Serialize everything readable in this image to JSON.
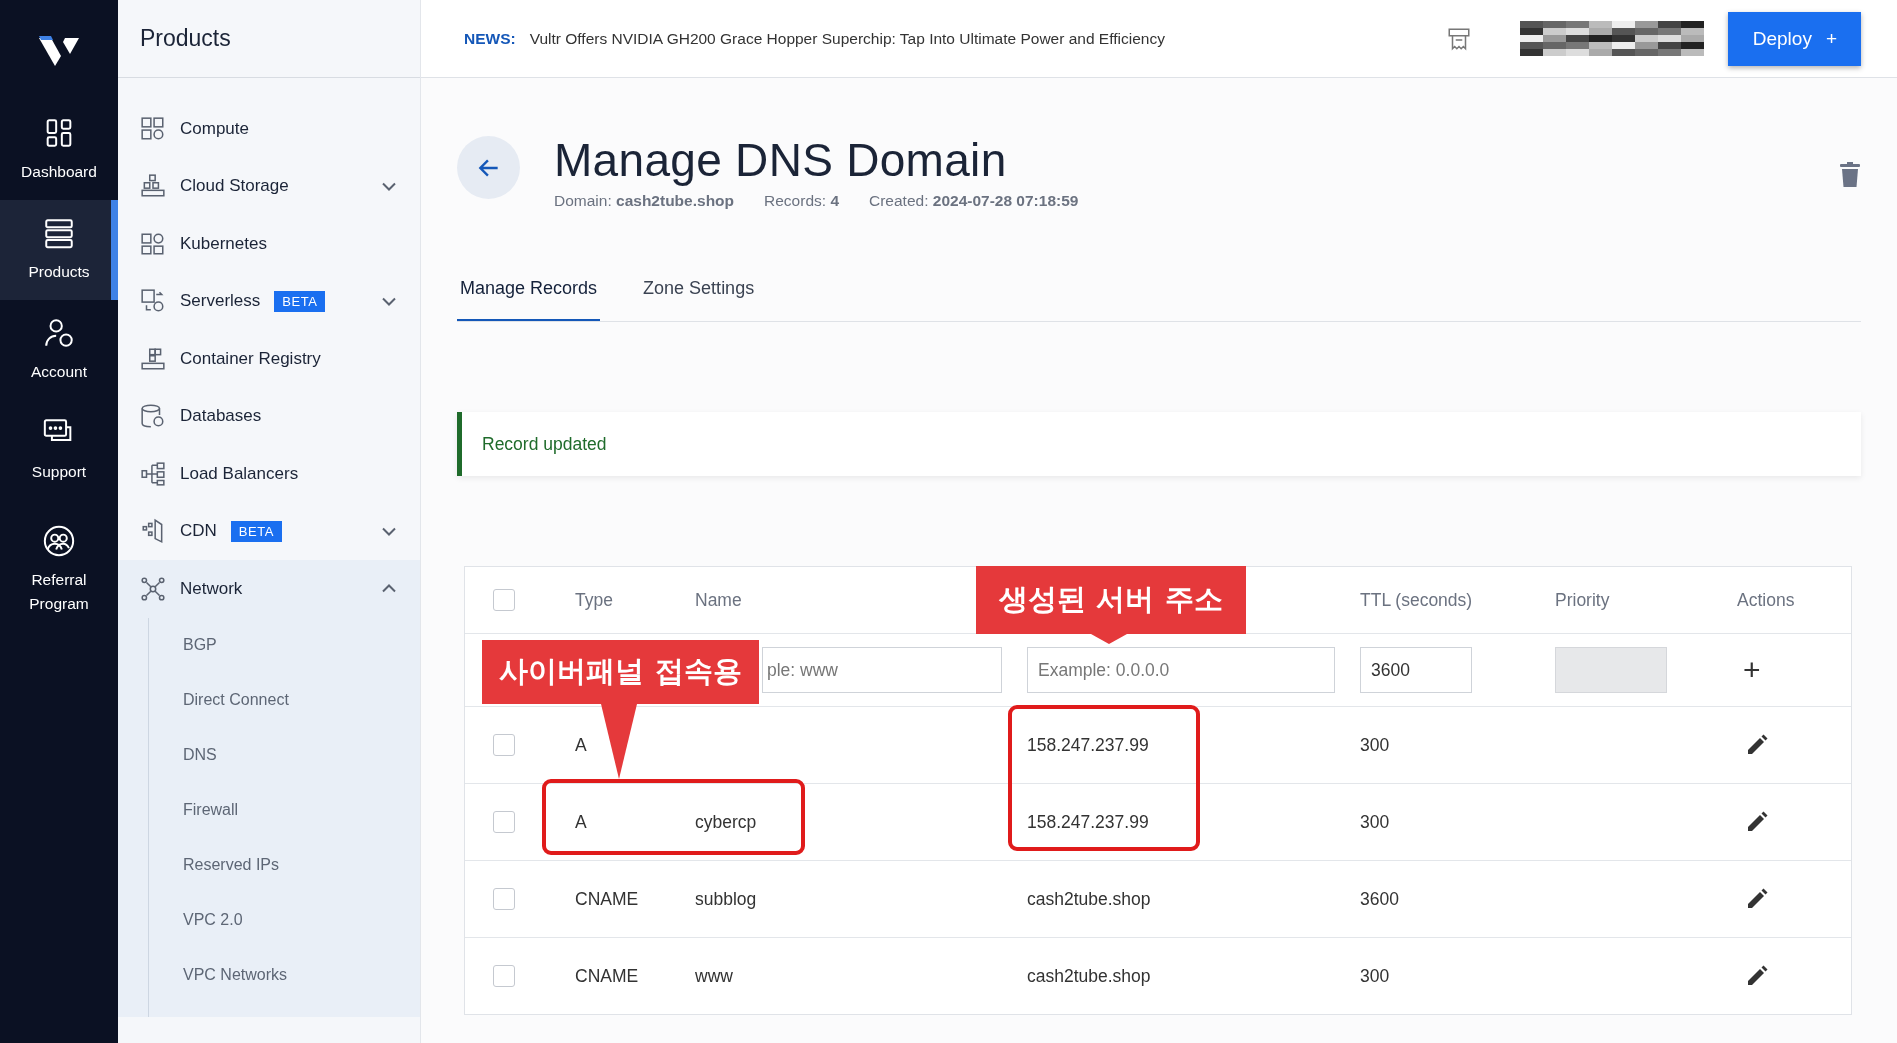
{
  "rail": {
    "items": [
      {
        "label": "Dashboard",
        "selected": false
      },
      {
        "label": "Products",
        "selected": true
      },
      {
        "label": "Account",
        "selected": false
      },
      {
        "label": "Support",
        "selected": false
      },
      {
        "label": "Referral Program",
        "selected": false
      }
    ]
  },
  "products": {
    "title": "Products",
    "items": [
      {
        "label": "Compute"
      },
      {
        "label": "Cloud Storage",
        "expanded": false
      },
      {
        "label": "Kubernetes"
      },
      {
        "label": "Serverless",
        "badge": "BETA",
        "expanded": false
      },
      {
        "label": "Container Registry"
      },
      {
        "label": "Databases"
      },
      {
        "label": "Load Balancers"
      },
      {
        "label": "CDN",
        "badge": "BETA",
        "expanded": false
      },
      {
        "label": "Network",
        "expanded": true,
        "children": [
          {
            "label": "BGP"
          },
          {
            "label": "Direct Connect"
          },
          {
            "label": "DNS"
          },
          {
            "label": "Firewall"
          },
          {
            "label": "Reserved IPs"
          },
          {
            "label": "VPC 2.0"
          },
          {
            "label": "VPC Networks"
          }
        ]
      }
    ]
  },
  "news": {
    "label": "NEWS:",
    "text": "Vultr Offers NVIDIA GH200 Grace Hopper Superchip: Tap Into Ultimate Power and Efficiency"
  },
  "deploy_button": {
    "label": "Deploy",
    "icon": "+"
  },
  "page": {
    "title": "Manage DNS Domain",
    "meta": [
      {
        "label": "Domain:",
        "value": "cash2tube.shop"
      },
      {
        "label": "Records:",
        "value": "4"
      },
      {
        "label": "Created:",
        "value": "2024-07-28 07:18:59"
      }
    ]
  },
  "tabs": [
    {
      "label": "Manage Records",
      "selected": true
    },
    {
      "label": "Zone Settings",
      "selected": false
    }
  ],
  "alert": {
    "text": "Record updated"
  },
  "table": {
    "columns": [
      "Type",
      "Name",
      "TTL (seconds)",
      "Priority",
      "Actions"
    ],
    "header_checked": false,
    "new_record": {
      "name_placeholder": "ple: www",
      "data_placeholder": "Example: 0.0.0.0",
      "ttl": "3600",
      "add_icon": "+"
    },
    "rows": [
      {
        "checked": false,
        "type": "A",
        "name": "",
        "data": "158.247.237.99",
        "ttl": "300"
      },
      {
        "checked": false,
        "type": "A",
        "name": "cybercp",
        "data": "158.247.237.99",
        "ttl": "300"
      },
      {
        "checked": false,
        "type": "CNAME",
        "name": "subblog",
        "data": "cash2tube.shop",
        "ttl": "3600"
      },
      {
        "checked": false,
        "type": "CNAME",
        "name": "www",
        "data": "cash2tube.shop",
        "ttl": "300"
      }
    ]
  },
  "annotations": [
    {
      "text": "사이버패널 접속용"
    },
    {
      "text": "생성된 서버 주소"
    }
  ]
}
